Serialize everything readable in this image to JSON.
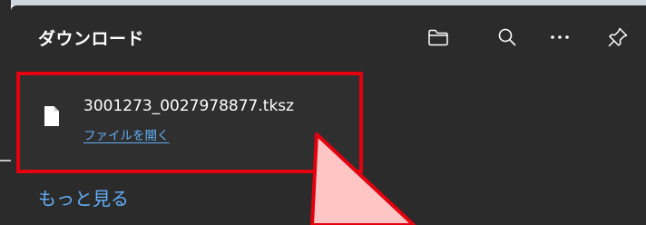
{
  "panel": {
    "title": "ダウンロード"
  },
  "header_icons": {
    "folder": "folder-icon",
    "search": "search-icon",
    "more": "more-options-icon",
    "pin": "pin-icon"
  },
  "download": {
    "file_name": "3001273_0027978877.tksz",
    "open_label": "ファイルを開く",
    "file_icon": "file-icon"
  },
  "footer": {
    "see_more_label": "もっと見る"
  },
  "colors": {
    "panel_bg": "#2b2b2b",
    "link": "#63aef7",
    "highlight_border": "#e3000f",
    "arrow_fill": "#ffc4c4"
  }
}
